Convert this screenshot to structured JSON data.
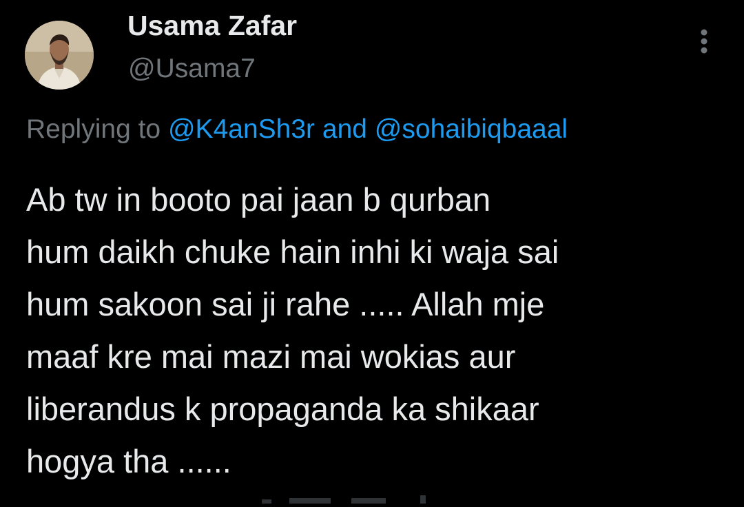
{
  "tweet": {
    "author": {
      "display_name": "Usama Zafar",
      "handle": "@Usama7",
      "avatar_icon": "user-avatar-photo"
    },
    "more_icon": "more-vertical-icon",
    "reply": {
      "prefix": "Replying to",
      "mention_1": "@K4anSh3r",
      "connector": "and",
      "mention_2": "@sohaibiqbaaal"
    },
    "text_lines": [
      "Ab tw in booto pai jaan b qurban",
      "hum daikh chuke hain inhi ki waja sai",
      "hum sakoon sai ji rahe ..... Allah mje",
      "maaf kre mai mazi mai wokias aur",
      "liberandus k propaganda ka shikaar",
      "hogya tha ......"
    ]
  },
  "colors": {
    "background": "#000000",
    "text_primary": "#e7e9ea",
    "text_secondary": "#71767b",
    "link": "#1d9bf0"
  }
}
